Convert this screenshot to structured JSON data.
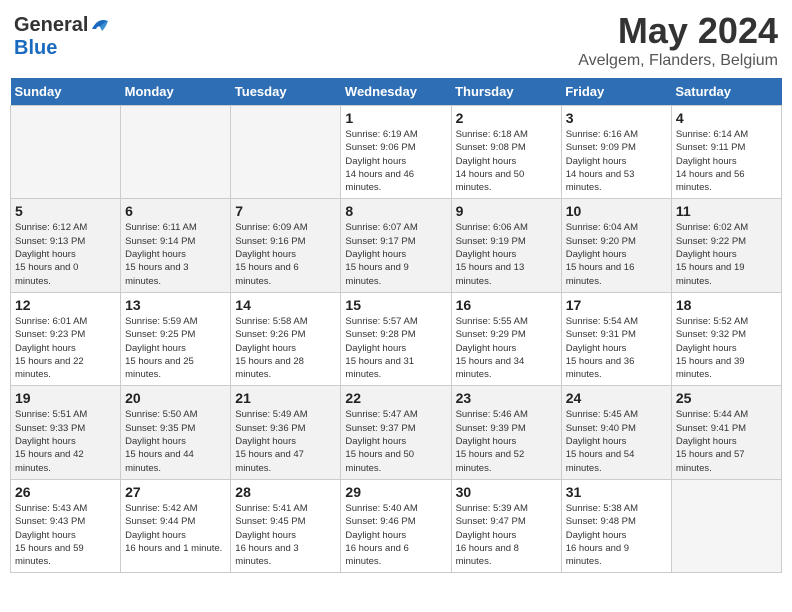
{
  "header": {
    "logo_general": "General",
    "logo_blue": "Blue",
    "month": "May 2024",
    "location": "Avelgem, Flanders, Belgium"
  },
  "days_of_week": [
    "Sunday",
    "Monday",
    "Tuesday",
    "Wednesday",
    "Thursday",
    "Friday",
    "Saturday"
  ],
  "weeks": [
    [
      {
        "day": "",
        "empty": true
      },
      {
        "day": "",
        "empty": true
      },
      {
        "day": "",
        "empty": true
      },
      {
        "day": "1",
        "sunrise": "6:19 AM",
        "sunset": "9:06 PM",
        "daylight": "14 hours and 46 minutes."
      },
      {
        "day": "2",
        "sunrise": "6:18 AM",
        "sunset": "9:08 PM",
        "daylight": "14 hours and 50 minutes."
      },
      {
        "day": "3",
        "sunrise": "6:16 AM",
        "sunset": "9:09 PM",
        "daylight": "14 hours and 53 minutes."
      },
      {
        "day": "4",
        "sunrise": "6:14 AM",
        "sunset": "9:11 PM",
        "daylight": "14 hours and 56 minutes."
      }
    ],
    [
      {
        "day": "5",
        "sunrise": "6:12 AM",
        "sunset": "9:13 PM",
        "daylight": "15 hours and 0 minutes."
      },
      {
        "day": "6",
        "sunrise": "6:11 AM",
        "sunset": "9:14 PM",
        "daylight": "15 hours and 3 minutes."
      },
      {
        "day": "7",
        "sunrise": "6:09 AM",
        "sunset": "9:16 PM",
        "daylight": "15 hours and 6 minutes."
      },
      {
        "day": "8",
        "sunrise": "6:07 AM",
        "sunset": "9:17 PM",
        "daylight": "15 hours and 9 minutes."
      },
      {
        "day": "9",
        "sunrise": "6:06 AM",
        "sunset": "9:19 PM",
        "daylight": "15 hours and 13 minutes."
      },
      {
        "day": "10",
        "sunrise": "6:04 AM",
        "sunset": "9:20 PM",
        "daylight": "15 hours and 16 minutes."
      },
      {
        "day": "11",
        "sunrise": "6:02 AM",
        "sunset": "9:22 PM",
        "daylight": "15 hours and 19 minutes."
      }
    ],
    [
      {
        "day": "12",
        "sunrise": "6:01 AM",
        "sunset": "9:23 PM",
        "daylight": "15 hours and 22 minutes."
      },
      {
        "day": "13",
        "sunrise": "5:59 AM",
        "sunset": "9:25 PM",
        "daylight": "15 hours and 25 minutes."
      },
      {
        "day": "14",
        "sunrise": "5:58 AM",
        "sunset": "9:26 PM",
        "daylight": "15 hours and 28 minutes."
      },
      {
        "day": "15",
        "sunrise": "5:57 AM",
        "sunset": "9:28 PM",
        "daylight": "15 hours and 31 minutes."
      },
      {
        "day": "16",
        "sunrise": "5:55 AM",
        "sunset": "9:29 PM",
        "daylight": "15 hours and 34 minutes."
      },
      {
        "day": "17",
        "sunrise": "5:54 AM",
        "sunset": "9:31 PM",
        "daylight": "15 hours and 36 minutes."
      },
      {
        "day": "18",
        "sunrise": "5:52 AM",
        "sunset": "9:32 PM",
        "daylight": "15 hours and 39 minutes."
      }
    ],
    [
      {
        "day": "19",
        "sunrise": "5:51 AM",
        "sunset": "9:33 PM",
        "daylight": "15 hours and 42 minutes."
      },
      {
        "day": "20",
        "sunrise": "5:50 AM",
        "sunset": "9:35 PM",
        "daylight": "15 hours and 44 minutes."
      },
      {
        "day": "21",
        "sunrise": "5:49 AM",
        "sunset": "9:36 PM",
        "daylight": "15 hours and 47 minutes."
      },
      {
        "day": "22",
        "sunrise": "5:47 AM",
        "sunset": "9:37 PM",
        "daylight": "15 hours and 50 minutes."
      },
      {
        "day": "23",
        "sunrise": "5:46 AM",
        "sunset": "9:39 PM",
        "daylight": "15 hours and 52 minutes."
      },
      {
        "day": "24",
        "sunrise": "5:45 AM",
        "sunset": "9:40 PM",
        "daylight": "15 hours and 54 minutes."
      },
      {
        "day": "25",
        "sunrise": "5:44 AM",
        "sunset": "9:41 PM",
        "daylight": "15 hours and 57 minutes."
      }
    ],
    [
      {
        "day": "26",
        "sunrise": "5:43 AM",
        "sunset": "9:43 PM",
        "daylight": "15 hours and 59 minutes."
      },
      {
        "day": "27",
        "sunrise": "5:42 AM",
        "sunset": "9:44 PM",
        "daylight": "16 hours and 1 minute."
      },
      {
        "day": "28",
        "sunrise": "5:41 AM",
        "sunset": "9:45 PM",
        "daylight": "16 hours and 3 minutes."
      },
      {
        "day": "29",
        "sunrise": "5:40 AM",
        "sunset": "9:46 PM",
        "daylight": "16 hours and 6 minutes."
      },
      {
        "day": "30",
        "sunrise": "5:39 AM",
        "sunset": "9:47 PM",
        "daylight": "16 hours and 8 minutes."
      },
      {
        "day": "31",
        "sunrise": "5:38 AM",
        "sunset": "9:48 PM",
        "daylight": "16 hours and 9 minutes."
      },
      {
        "day": "",
        "empty": true
      }
    ]
  ]
}
